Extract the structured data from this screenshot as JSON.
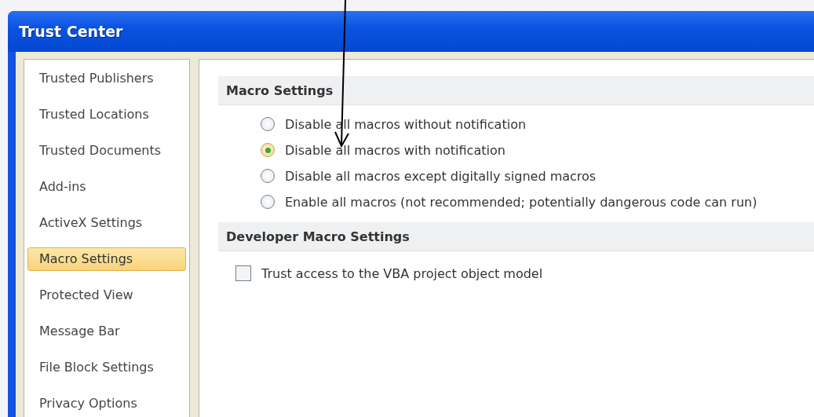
{
  "window": {
    "title": "Trust Center"
  },
  "sidebar": {
    "items": [
      {
        "label": "Trusted Publishers",
        "selected": false
      },
      {
        "label": "Trusted Locations",
        "selected": false
      },
      {
        "label": "Trusted Documents",
        "selected": false
      },
      {
        "label": "Add-ins",
        "selected": false
      },
      {
        "label": "ActiveX Settings",
        "selected": false
      },
      {
        "label": "Macro Settings",
        "selected": true
      },
      {
        "label": "Protected View",
        "selected": false
      },
      {
        "label": "Message Bar",
        "selected": false
      },
      {
        "label": "File Block Settings",
        "selected": false
      },
      {
        "label": "Privacy Options",
        "selected": false
      }
    ]
  },
  "sections": [
    {
      "title": "Macro Settings",
      "options": [
        {
          "kind": "radio",
          "label": "Disable all macros without notification",
          "selected": false
        },
        {
          "kind": "radio",
          "label": "Disable all macros with notification",
          "selected": true
        },
        {
          "kind": "radio",
          "label": "Disable all macros except digitally signed macros",
          "selected": false
        },
        {
          "kind": "radio",
          "label": "Enable all macros (not recommended; potentially dangerous code can run)",
          "selected": false
        }
      ]
    },
    {
      "title": "Developer Macro Settings",
      "options": [
        {
          "kind": "checkbox",
          "label": "Trust access to the VBA project object model",
          "checked": false
        }
      ]
    }
  ]
}
